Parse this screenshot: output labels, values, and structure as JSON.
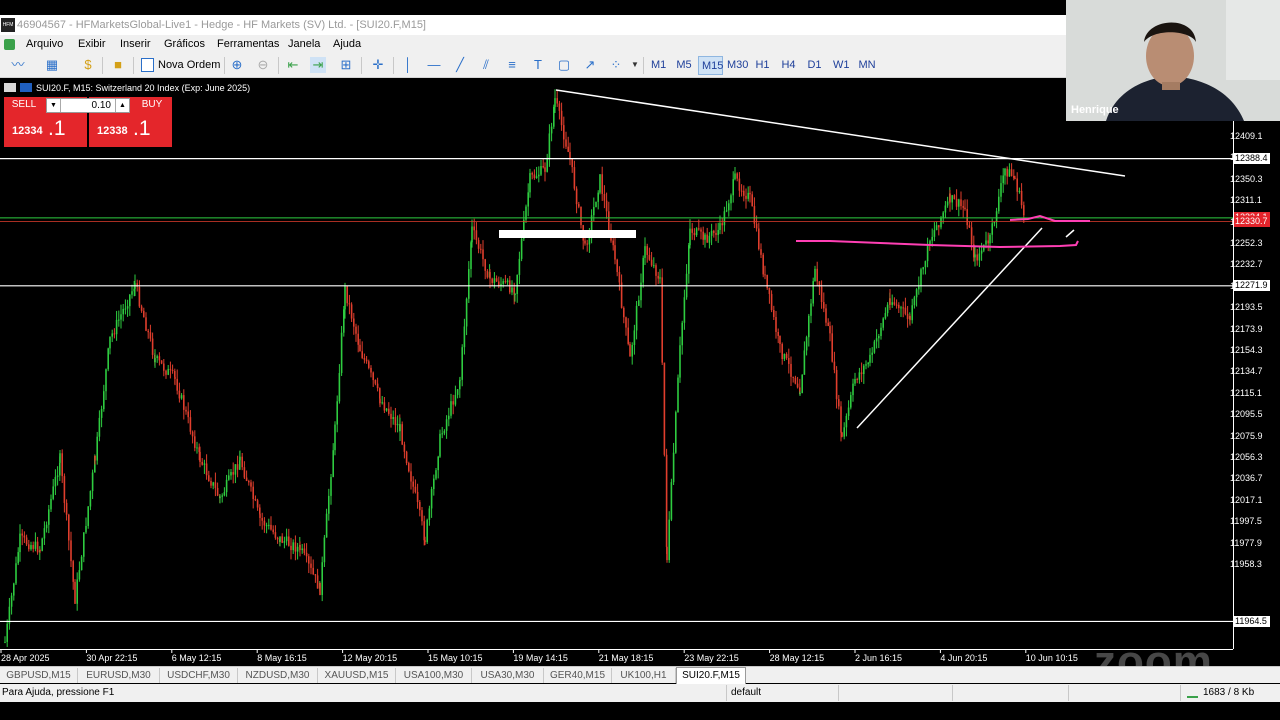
{
  "window": {
    "title": "46904567 - HFMarketsGlobal-Live1 - Hedge - HF Markets (SV) Ltd. - [SUI20.F,M15]",
    "logo_text": "HFM"
  },
  "menu": [
    "Arquivo",
    "Exibir",
    "Inserir",
    "Gráficos",
    "Ferramentas",
    "Janela",
    "Ajuda"
  ],
  "toolbar": {
    "new_order_label": "Nova Ordem",
    "timeframes": [
      "M1",
      "M5",
      "M15",
      "M30",
      "H1",
      "H4",
      "D1",
      "W1",
      "MN"
    ],
    "active_timeframe": "M15"
  },
  "chart": {
    "header": "SUI20.F, M15:  Switzerland 20 Index (Exp: June 2025)",
    "one_click": {
      "sell_label": "SELL",
      "buy_label": "BUY",
      "lot": "0.10",
      "sell_price_small": "12334",
      "sell_price_big": ".1",
      "buy_price_small": "12338",
      "buy_price_big": ".1",
      "color": "#e4262b"
    },
    "price_ticks": [
      "12409.1",
      "12369.9",
      "12350.3",
      "12311.1",
      "12291.5",
      "12252.3",
      "12232.7",
      "12213.1",
      "12193.5",
      "12173.9",
      "12154.3",
      "12134.7",
      "12115.1",
      "12095.5",
      "12075.9",
      "12056.3",
      "12036.7",
      "12017.1",
      "11997.5",
      "11977.9",
      "11958.3"
    ],
    "price_tags": {
      "upper_line": "12388.4",
      "mid_line": "12271.9",
      "lower_line": "11964.5",
      "current_bid": "12334.1",
      "current_ask": "12330.7"
    },
    "time_ticks": [
      "28 Apr 2025",
      "30 Apr 22:15",
      "6 May 12:15",
      "8 May 16:15",
      "12 May 20:15",
      "15 May 10:15",
      "19 May 14:15",
      "21 May 18:15",
      "23 May 22:15",
      "28 May 12:15",
      "2 Jun 16:15",
      "4 Jun 20:15",
      "10 Jun 10:15"
    ],
    "colors": {
      "bull_candle": "#2ecc40",
      "bear_candle": "#e03e2d",
      "trendline": "#ffffff",
      "annotation": "#ff3fb4",
      "bid_line": "#2ecc40"
    }
  },
  "symbol_tabs": [
    "GBPUSD,M15",
    "EURUSD,M30",
    "USDCHF,M30",
    "NZDUSD,M30",
    "XAUUSD,M15",
    "USA100,M30",
    "USA30,M30",
    "GER40,M15",
    "UK100,H1",
    "SUI20.F,M15"
  ],
  "active_tab": "SUI20.F,M15",
  "status": {
    "help": "Para Ajuda, pressione F1",
    "profile": "default",
    "traffic": "1683 / 8 Kb"
  },
  "webcam": {
    "name": "Henrique"
  },
  "watermark": "zoom"
}
